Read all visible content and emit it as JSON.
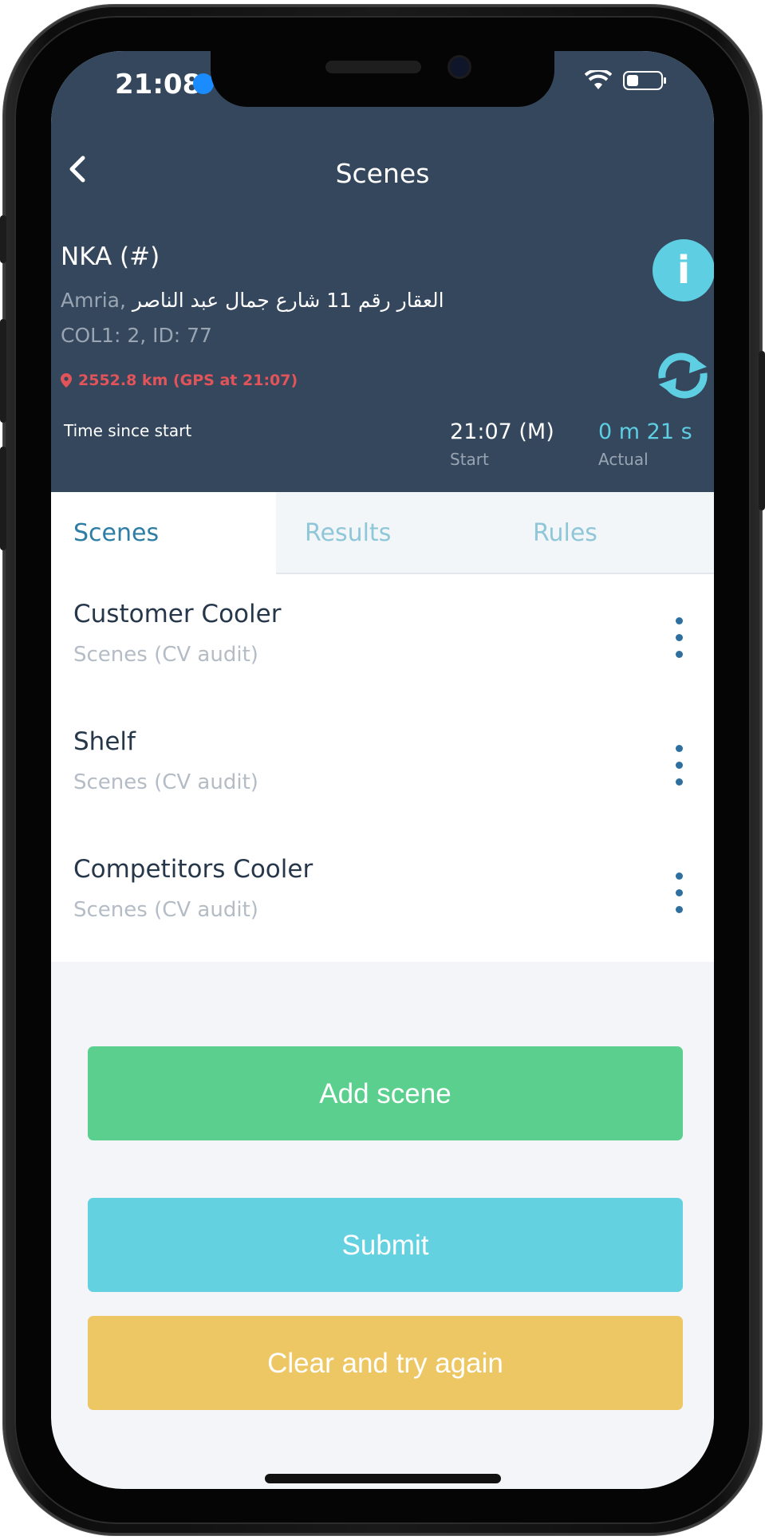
{
  "status_bar": {
    "time": "21:08"
  },
  "nav": {
    "title": "Scenes"
  },
  "store": {
    "name": "NKA (#)",
    "address_latin": "Amria, ",
    "address_arabic": "العقار رقم 11 شارع جمال عبد الناصر",
    "ids": "COL1: 2, ID: 77",
    "gps": "2552.8 km (GPS at 21:07)"
  },
  "timer": {
    "label": "Time since start",
    "start_value": "21:07 (M)",
    "start_label": "Start",
    "actual_value": "0 m 21 s",
    "actual_label": "Actual"
  },
  "tabs": [
    {
      "label": "Scenes",
      "active": true
    },
    {
      "label": "Results",
      "active": false
    },
    {
      "label": "Rules",
      "active": false
    }
  ],
  "scenes": [
    {
      "title": "Customer Cooler",
      "subtitle": "Scenes (CV audit)"
    },
    {
      "title": "Shelf",
      "subtitle": "Scenes (CV audit)"
    },
    {
      "title": "Competitors Cooler",
      "subtitle": "Scenes (CV audit)"
    }
  ],
  "buttons": {
    "add_scene": "Add scene",
    "submit": "Submit",
    "clear": "Clear and try again"
  },
  "icons": {
    "back": "chevron-left-icon",
    "info": "info-icon",
    "sync": "sync-icon",
    "pin": "map-pin-icon",
    "menu": "kebab-menu-icon",
    "info_glyph": "i"
  },
  "colors": {
    "header_bg": "#34475d",
    "accent_cyan": "#5ecfe3",
    "add_green": "#5bcf8d",
    "submit_cyan": "#64d1e1",
    "clear_yellow": "#eec765",
    "gps_red": "#e2545a"
  }
}
